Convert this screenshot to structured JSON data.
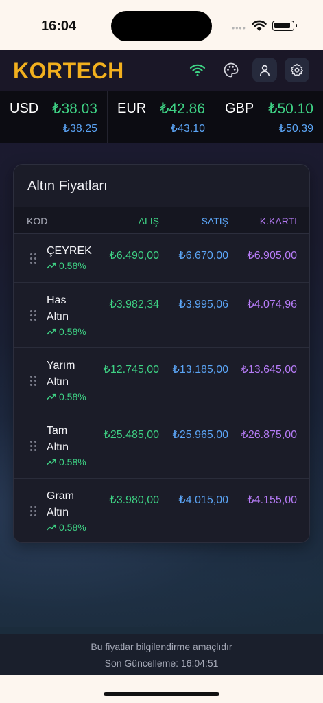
{
  "status_bar": {
    "time": "16:04",
    "dots": "••••"
  },
  "header": {
    "brand": "KORTECH",
    "icons": [
      "wifi-icon",
      "palette-icon",
      "user-icon",
      "settings-icon"
    ],
    "colors": {
      "brand": "#f2b01e",
      "wifi": "#3ed184"
    }
  },
  "ticker": [
    {
      "code": "USD",
      "buy": "₺38.03",
      "sell": "₺38.25"
    },
    {
      "code": "EUR",
      "buy": "₺42.86",
      "sell": "₺43.10"
    },
    {
      "code": "GBP",
      "buy": "₺50.10",
      "sell": "₺50.39"
    }
  ],
  "card": {
    "title": "Altın Fiyatları",
    "columns": {
      "kod": "KOD",
      "alis": "ALIŞ",
      "satis": "SATIŞ",
      "kk": "K.KARTI"
    },
    "rows": [
      {
        "name_line1": "ÇEYREK",
        "name_line2": "",
        "change": "0.58%",
        "alis": "₺6.490,00",
        "satis": "₺6.670,00",
        "kk": "₺6.905,00"
      },
      {
        "name_line1": "Has",
        "name_line2": "Altın",
        "change": "0.58%",
        "alis": "₺3.982,34",
        "satis": "₺3.995,06",
        "kk": "₺4.074,96"
      },
      {
        "name_line1": "Yarım",
        "name_line2": "Altın",
        "change": "0.58%",
        "alis": "₺12.745,00",
        "satis": "₺13.185,00",
        "kk": "₺13.645,00"
      },
      {
        "name_line1": "Tam",
        "name_line2": "Altın",
        "change": "0.58%",
        "alis": "₺25.485,00",
        "satis": "₺25.965,00",
        "kk": "₺26.875,00"
      },
      {
        "name_line1": "Gram",
        "name_line2": "Altın",
        "change": "0.58%",
        "alis": "₺3.980,00",
        "satis": "₺4.015,00",
        "kk": "₺4.155,00"
      }
    ],
    "colors": {
      "alis": "#3ed184",
      "satis": "#5ba4f5",
      "kk": "#b57bf5"
    }
  },
  "footer": {
    "disclaimer": "Bu fiyatlar bilgilendirme amaçlıdır",
    "last_update": "Son Güncelleme: 16:04:51"
  }
}
